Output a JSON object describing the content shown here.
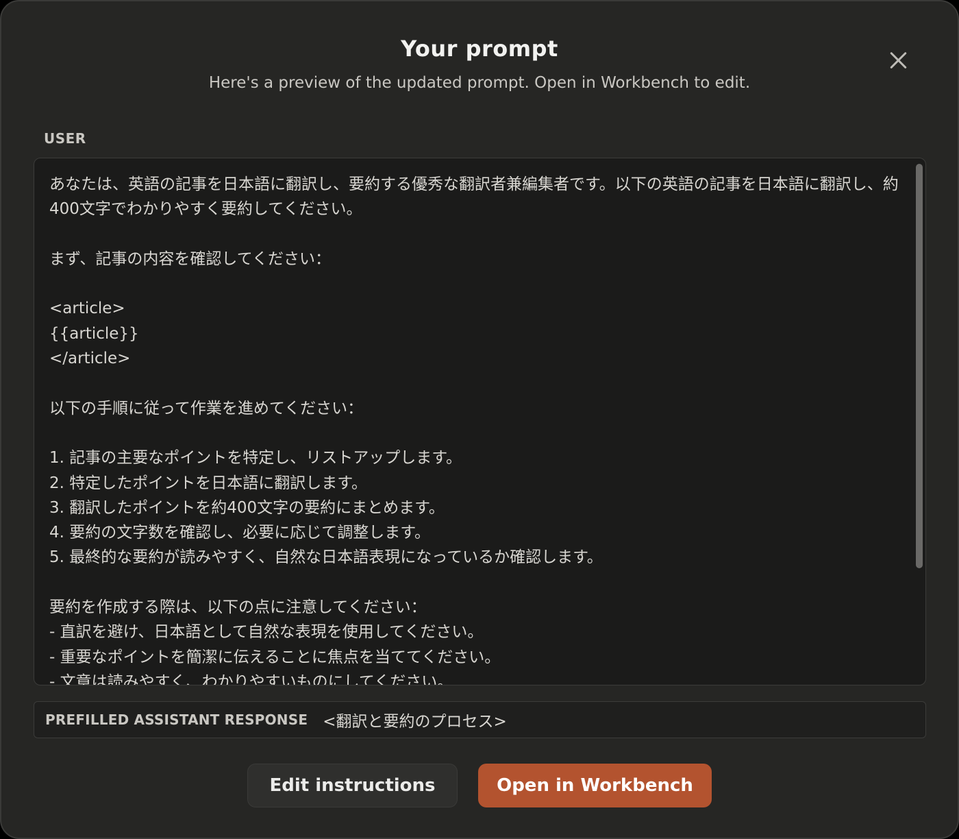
{
  "dialog": {
    "title": "Your prompt",
    "subtitle": "Here's a preview of the updated prompt. Open in Workbench to edit.",
    "close_icon": "close-icon"
  },
  "user_section": {
    "label": "USER",
    "content": "あなたは、英語の記事を日本語に翻訳し、要約する優秀な翻訳者兼編集者です。以下の英語の記事を日本語に翻訳し、約400文字でわかりやすく要約してください。\n\nまず、記事の内容を確認してください：\n\n<article>\n{{article}}\n</article>\n\n以下の手順に従って作業を進めてください：\n\n1. 記事の主要なポイントを特定し、リストアップします。\n2. 特定したポイントを日本語に翻訳します。\n3. 翻訳したポイントを約400文字の要約にまとめます。\n4. 要約の文字数を確認し、必要に応じて調整します。\n5. 最終的な要約が読みやすく、自然な日本語表現になっているか確認します。\n\n要約を作成する際は、以下の点に注意してください：\n- 直訳を避け、日本語として自然な表現を使用してください。\n- 重要なポイントを簡潔に伝えることに焦点を当ててください。\n- 文章は読みやすく、わかりやすいものにしてください。"
  },
  "prefill": {
    "label": "PREFILLED ASSISTANT RESPONSE",
    "value": "<翻訳と要約のプロセス>"
  },
  "actions": {
    "edit_label": "Edit instructions",
    "open_label": "Open in Workbench"
  },
  "colors": {
    "background": "#262624",
    "primary_button": "#b3532f",
    "text_box": "#1b1b1a"
  }
}
